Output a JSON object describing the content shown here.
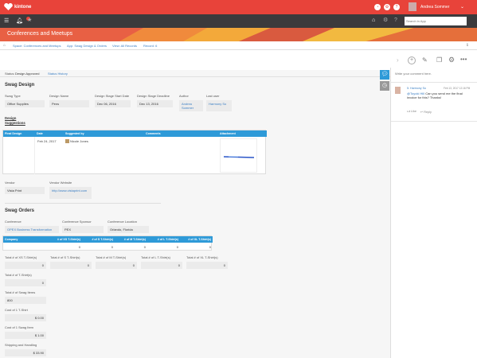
{
  "app": {
    "brand": "kintone",
    "user": "Andrea Sommer",
    "search_placeholder": "Search in App"
  },
  "banner": {
    "title": "Conferences and Meetups"
  },
  "breadcrumb": [
    "Space: Conferences and Meetups",
    "App: Swag Design & Orders",
    "View: All Records",
    "Record: 6"
  ],
  "status": {
    "label": "Status:",
    "value": "Design Approved",
    "history": "Status History"
  },
  "swag_design": {
    "heading": "Swag Design",
    "fields": [
      {
        "label": "Swag Type",
        "value": "Office Supplies"
      },
      {
        "label": "Design Name",
        "value": "Pens"
      },
      {
        "label": "Design Stage Start Date",
        "value": "Dec 06, 2016"
      },
      {
        "label": "Design Stage Deadline",
        "value": "Dec 13, 2016"
      },
      {
        "label": "Author",
        "value": "Andrea Sommer"
      },
      {
        "label": "Last user",
        "value": "Harmony So"
      }
    ],
    "suggestions_title": "Design Suggestions",
    "table": {
      "headers": [
        "Final Design",
        "Date",
        "Suggested by",
        "Comments",
        "Attachment"
      ],
      "row": {
        "date": "Feb 24, 2017",
        "suggested_by": "Nicole Jones"
      }
    },
    "vendor": {
      "label": "Vendor",
      "value": "Vista Print"
    },
    "vendor_site": {
      "label": "Vendor Website",
      "value": "http://www.vistaprint.com"
    }
  },
  "swag_orders": {
    "heading": "Swag Orders",
    "fields": [
      {
        "label": "Conference",
        "value": "OPEX Business Transformation"
      },
      {
        "label": "Conference Sponsor",
        "value": "PEX"
      },
      {
        "label": "Conference Location",
        "value": "Orlando, Florida"
      }
    ],
    "table": {
      "headers": [
        "Company",
        "# of XS T-Shirt(s)",
        "# of S T-Shirt(s)",
        "# of M T-Shirt(s)",
        "# of L T-Shirt(s)",
        "# of XL T-Shirt(s)"
      ],
      "values": [
        "0",
        "0",
        "0",
        "0",
        "0"
      ]
    },
    "totals": [
      {
        "label": "Total # of XS T-Shirt(s)",
        "value": "0"
      },
      {
        "label": "Total # of S T-Shirt(s)",
        "value": "0"
      },
      {
        "label": "Total # of M T-Shirt(s)",
        "value": "0"
      },
      {
        "label": "Total # of L T-Shirt(s)",
        "value": "0"
      },
      {
        "label": "Total # of XL T-Shirt(s)",
        "value": "0"
      }
    ],
    "total_tshirts": {
      "label": "Total # of T-Shirt(s)",
      "value": "0"
    },
    "total_swag": {
      "label": "Total # of Swag Items",
      "value": "800"
    },
    "cost_tshirt": {
      "label": "Cost of 1 T-Shirt",
      "value": "$ 0.00"
    },
    "cost_swag": {
      "label": "Cost of 1 Swag Item",
      "value": "$ 1.00"
    },
    "shipping": {
      "label": "Shipping and Handling",
      "value": "$ 33.90"
    }
  },
  "comments": {
    "placeholder": "Write your comment here.",
    "items": [
      {
        "author": "5: Harmony So",
        "date": "Feb 13, 2017 12:16 PM",
        "mention": "@Toyoki Hill",
        "text": "Can you send me the final invoice for this? Thanks!",
        "like": "Like",
        "reply": "Reply"
      }
    ]
  },
  "colors": {
    "topbar": "#e8433a",
    "nav": "#3c3a3c",
    "accent": "#2e9ad8"
  }
}
